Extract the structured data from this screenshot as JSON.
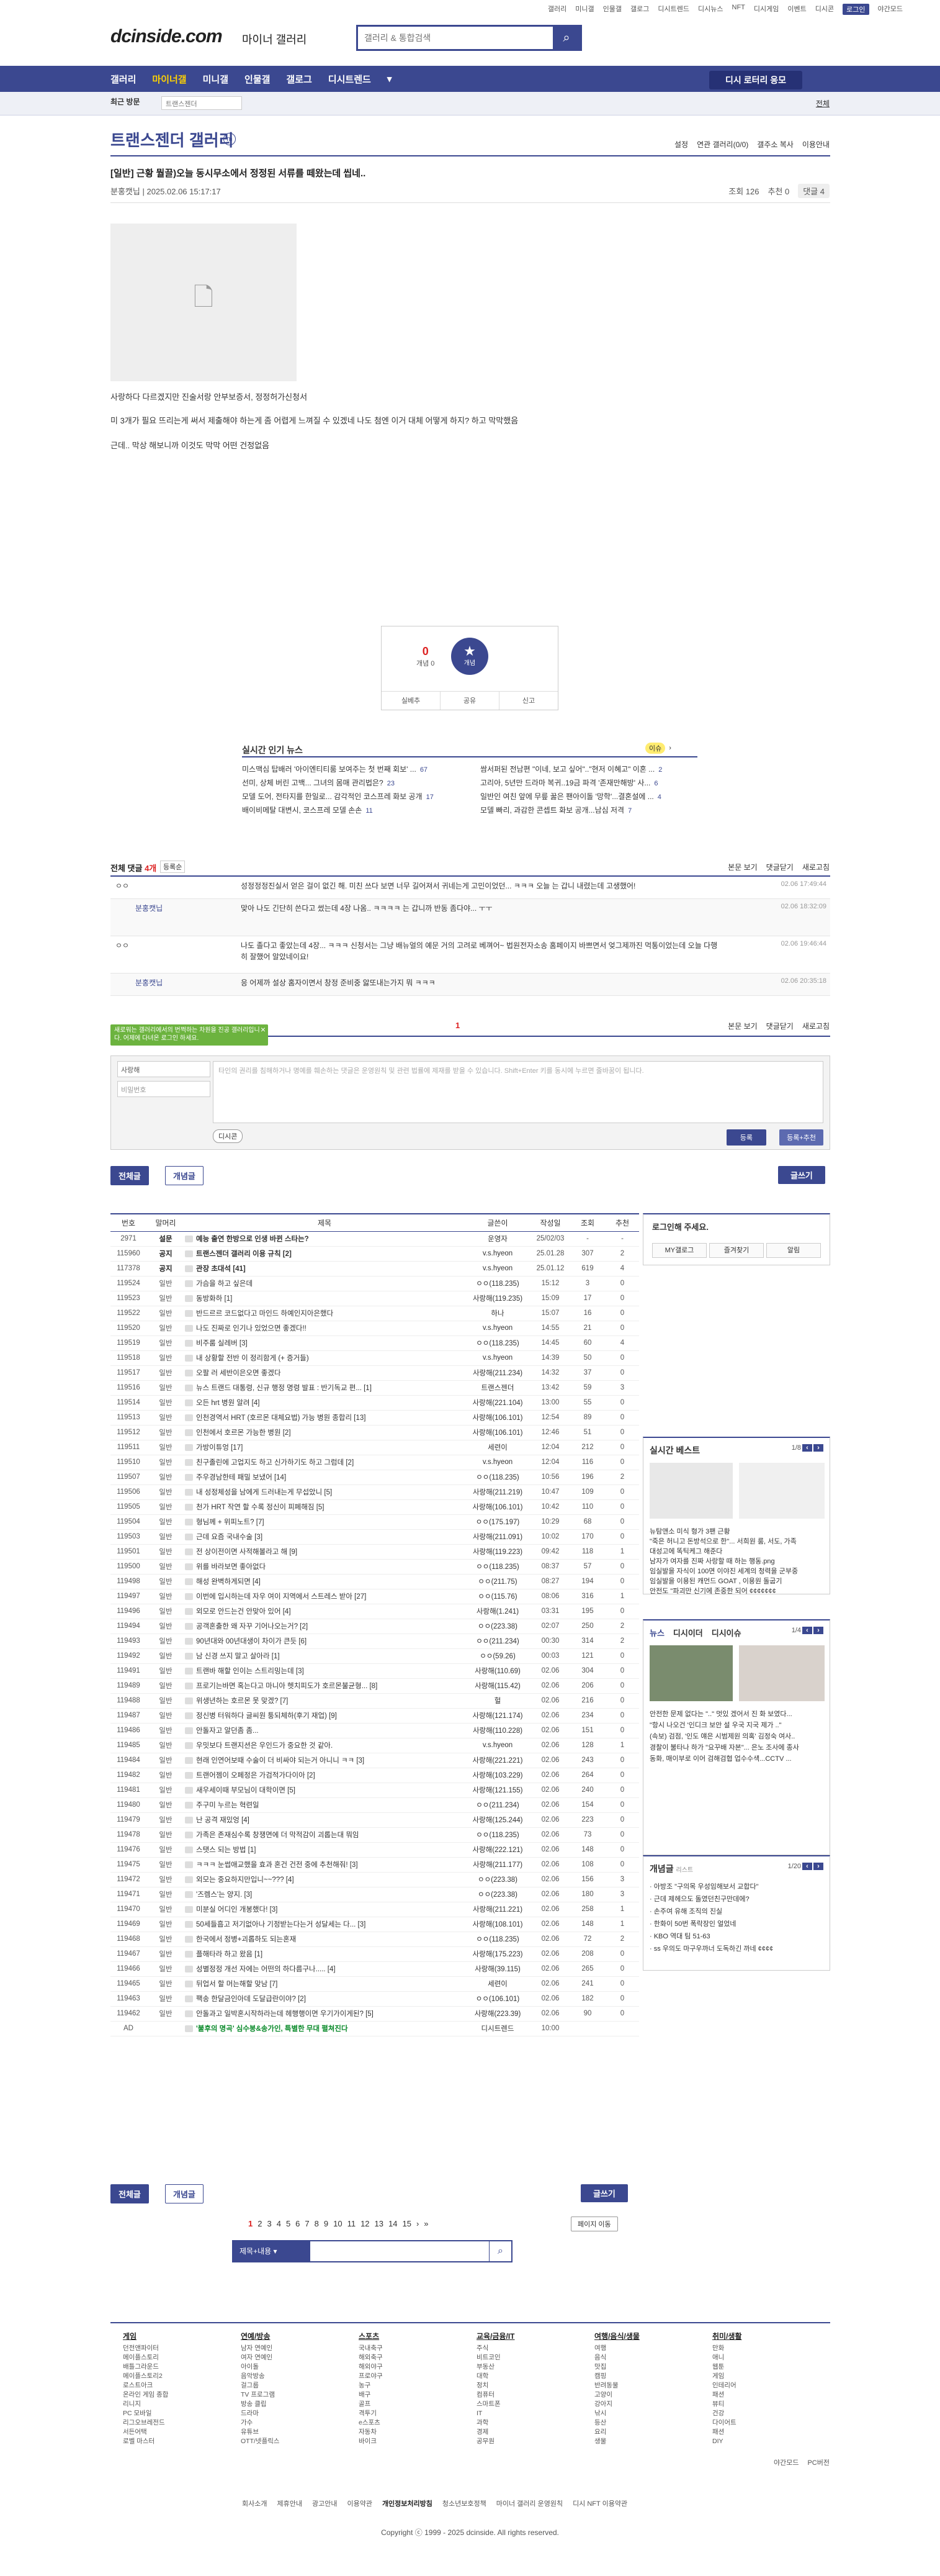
{
  "topmenu": [
    "갤러리",
    "미니갤",
    "인물갤",
    "갤로그",
    "디시트렌드",
    "디시뉴스",
    "NFT",
    "디시게임",
    "이벤트",
    "디시콘",
    "로그인",
    "야간모드"
  ],
  "logo": "dcinside.com",
  "logo_sub": "마이너 갤러리",
  "search": {
    "placeholder": "갤러리 & 통합검색"
  },
  "gnb": [
    "갤러리",
    "마이너갤",
    "미니갤",
    "인물갤",
    "갤로그",
    "디시트렌드"
  ],
  "gnb_right": "디시 로터리 응모",
  "subbar": {
    "recent": "최근 방문",
    "recent_box": "트랜스젠더",
    "fold": "전체"
  },
  "gallery": {
    "title": "트랜스젠더 갤러리",
    "badge": "m",
    "menu": [
      "설정",
      "연관 갤러리(0/0)",
      "갤주소 복사",
      "이용안내"
    ]
  },
  "post": {
    "title": "[일반] 근황 뭘끌)오늘 동시무소에서 정정된 서류를 떼왔는데 씹네..",
    "author": "분홍캣닙",
    "date": "2025.02.06 15:17:17",
    "views": "조회 126",
    "rec": "추천 0",
    "comments": "댓글 4",
    "body1": "사랑하다 다르겠지만 진술서랑 안부보증서, 정정허가신청서",
    "body2": "미 3개가 필요 뜨리는게 써서 제출해야 하는게 좀 어렵게 느껴질 수 있겠네 나도 첨엔 이거 대체 어떻게 하지? 하고 막막했음",
    "body3": "근데.. 막상 해보니까 이것도 막막 어떤 건정없음"
  },
  "rec": {
    "up": "0",
    "up_label": "개념 0",
    "star": "★",
    "star_label": "개념",
    "btns": [
      "실베추",
      "공유",
      "신고"
    ]
  },
  "hotnews": {
    "title": "실시간 인기 뉴스",
    "badge": "이슈",
    "rows": [
      [
        "미스맥심 탑배러 '아이엔티티룸 보여주는 첫 번째 회보' ...",
        "67"
      ],
      [
        "쌈서퍼된 전남편 \"이네, 보고 싶어\"..\"현저 이혜고\" 이혼 ...",
        "2"
      ],
      [
        "선미, 상체 버린 고백... 그녀의 몸매 관리법은?",
        "23"
      ],
      [
        "고리아, 5년만 드라마 복귀..19금 파격 '존재만해방' 사...",
        "6"
      ],
      [
        "모델 도어, 전타지를 한일로... 감각적인 코스프레 화보 공개",
        "17"
      ],
      [
        "일반인 여친 앞에 무릎 꿇은 팬아이돌 '망학'...결혼설에 ...",
        "4"
      ],
      [
        "배이비메탈 대변시, 코스프레 모델 손손",
        "11"
      ],
      [
        "모델 빠리, 과감한 콘셉트 화보 공개...남심 저격",
        "7"
      ]
    ]
  },
  "comments": {
    "label": "전체 댓글",
    "count": "4개",
    "sort": "등록순",
    "right": [
      "본문 보기",
      "댓글닫기",
      "새로고침"
    ],
    "rows": [
      {
        "nick": "ㅇㅇ",
        "text": "성정정정진실서 얻은 걸이 없긴 해. 미친 쓰다 보면 너무 길어져서 귀네는게 고민이었던... ㅋㅋㅋ 오늘 는 갑니 내렸는데 고생했어!",
        "date": "02.06 17:49:44"
      },
      {
        "nick": "분홍캣닙",
        "text": "맞아 나도 긴단히 쓴다고 썼는데 4장 나옴.. ㅋㅋㅋㅋ 는 갑니까 반동 좀다야... ㅜㅜ",
        "date": "02.06 18:32:09"
      },
      {
        "nick": "ㅇㅇ",
        "text": "나도 졸다고 좋았는데 4장... ㅋㅋㅋ 신청서는 그냥 배뉴얼의 예문 거의 고려로 베껴어~ 법원전자소송 홈페이지 바쁘면서 엊그제까진 먹통이었는데 오늘 다행히 잘했어 알았네이요!",
        "date": "02.06 19:46:44"
      },
      {
        "nick": "분홍캣닙",
        "text": "응 어제까 설상 홈자이면서 창정 준비중 앓또내는가지 뭐 ㅋㅋㅋ",
        "date": "02.06 20:35:18"
      }
    ]
  },
  "cmt_page": "1",
  "tooltip": "새로워는 갤러리에서의 번쩍하는 차원을 진공 갤러리입니다. 어제에 다녀온 로그인 하세요.",
  "writebox": {
    "id_value": "ㅇㅇ",
    "id_label": "사랑해",
    "pw": "비밀번호",
    "text": "타인의 권리를 침해하거나 명예를 훼손하는 댓글은 운영원칙 및 관련 법률에 제재를 받을 수 있습니다. Shift+Enter 키를 동시에 누르면 줄바꿈이 됩니다.",
    "dccon": "디시콘",
    "reg": "등록",
    "regrec": "등록+추천"
  },
  "tabs": {
    "all": "전체글",
    "rec": "개념글",
    "write": "글쓰기"
  },
  "list": {
    "headers": [
      "번호",
      "말머리",
      "제목",
      "글쓴이",
      "작성일",
      "조회",
      "추천"
    ],
    "rows": [
      [
        "2971",
        "설문",
        "예능 출연 한방으로 인생 바뀐 스타는?",
        "운영자",
        "25/02/03",
        "-",
        "-",
        "n"
      ],
      [
        "115960",
        "공지",
        "트랜스젠더 갤러리 이용 규칙 [2]",
        "v.s.hyeon",
        "25.01.28",
        "307",
        "2",
        "n"
      ],
      [
        "117378",
        "공지",
        "관장 초대석 [41]",
        "v.s.hyeon",
        "25.01.12",
        "619",
        "4",
        "n"
      ],
      [
        "119524",
        "일반",
        "가슴을 하고 싶은데",
        "ㅇㅇ(118.235)",
        "15:12",
        "3",
        "0",
        ""
      ],
      [
        "119523",
        "일반",
        "동방화하 [1]",
        "사랑해(119.235)",
        "15:09",
        "17",
        "0",
        ""
      ],
      [
        "119522",
        "일반",
        "반드르르 코드없다고 마인드 하예인지아은했다",
        "하나",
        "15:07",
        "16",
        "0",
        ""
      ],
      [
        "119520",
        "일반",
        "나도 진짜로 인기나 있었으면 좋겠다!!",
        "v.s.hyeon",
        "14:55",
        "21",
        "0",
        ""
      ],
      [
        "119519",
        "일반",
        "비주룸 실레버 [3]",
        "ㅇㅇ(118.235)",
        "14:45",
        "60",
        "4",
        ""
      ],
      [
        "119518",
        "일반",
        "내 상황할 전반 이 정리함게 (+ 증거들)",
        "v.s.hyeon",
        "14:39",
        "50",
        "0",
        ""
      ],
      [
        "119517",
        "일반",
        "오팔 러 세반이은오면 좋겠다",
        "사랑해(211.234)",
        "14:32",
        "37",
        "0",
        ""
      ],
      [
        "119516",
        "일반",
        "뉴스 트랜드 대통령, 신규 행정 명령 발표 : 반기독교 편... [1]",
        "트랜스젠더",
        "13:42",
        "59",
        "3",
        ""
      ],
      [
        "119514",
        "일반",
        "오든 hrt 병원 알려 [4]",
        "사랑해(221.104)",
        "13:00",
        "55",
        "0",
        ""
      ],
      [
        "119513",
        "일반",
        "인천경역서 HRT (호르몬 대체요법) 가능 병원 종합리 [13]",
        "사랑해(106.101)",
        "12:54",
        "89",
        "0",
        ""
      ],
      [
        "119512",
        "일반",
        "인천에서 호르몬 가능한 병원 [2]",
        "사랑해(106.101)",
        "12:46",
        "51",
        "0",
        ""
      ],
      [
        "119511",
        "일반",
        "가방이튜엉 [17]",
        "세련이",
        "12:04",
        "212",
        "0",
        ""
      ],
      [
        "119510",
        "일반",
        "친구졸린에 고업지도 하고 신가하기도 하고 그럼데 [2]",
        "v.s.hyeon",
        "12:04",
        "116",
        "0",
        ""
      ],
      [
        "119507",
        "일반",
        "주우경남한테 패밀 보냈어 [14]",
        "ㅇㅇ(118.235)",
        "10:56",
        "196",
        "2",
        ""
      ],
      [
        "119506",
        "일반",
        "내 성정체성을 남에게 드러내는게 무섭았니 [5]",
        "사랑해(211.219)",
        "10:47",
        "109",
        "0",
        ""
      ],
      [
        "119505",
        "일반",
        "천가 HRT 작연 할 수록 정신이 피페해짐 [5]",
        "사랑해(106.101)",
        "10:42",
        "110",
        "0",
        ""
      ],
      [
        "119504",
        "일반",
        "형님께 + 위피노트? [7]",
        "ㅇㅇ(175.197)",
        "10:29",
        "68",
        "0",
        ""
      ],
      [
        "119503",
        "일반",
        "근데 요즘 국내수술 [3]",
        "사랑해(211.091)",
        "10:02",
        "170",
        "0",
        ""
      ],
      [
        "119501",
        "일반",
        "전 상이전이면 사적해볼라고 해 [9]",
        "사랑해(119.223)",
        "09:42",
        "118",
        "1",
        ""
      ],
      [
        "119500",
        "일반",
        "위를 바라보면 좋아없다",
        "ㅇㅇ(118.235)",
        "08:37",
        "57",
        "0",
        ""
      ],
      [
        "119498",
        "일반",
        "해성 완벽하게되면 [4]",
        "ㅇㅇ(211.75)",
        "08:27",
        "194",
        "0",
        ""
      ],
      [
        "119497",
        "일반",
        "이번에 입시하는데 자우 여이 지역에서 스트레스 받아 [27]",
        "ㅇㅇ(115.76)",
        "08:06",
        "316",
        "1",
        ""
      ],
      [
        "119496",
        "일반",
        "외모로 안드는건 안맞아 있어 [4]",
        "사랑해(1.241)",
        "03:31",
        "195",
        "0",
        ""
      ],
      [
        "119494",
        "일반",
        "공객혼출한 왜 자꾸 기어나오는거? [2]",
        "ㅇㅇ(223.38)",
        "02:07",
        "250",
        "2",
        ""
      ],
      [
        "119493",
        "일반",
        "90년대와 00년대생이 차이가 큰듯 [6]",
        "ㅇㅇ(211.234)",
        "00:30",
        "314",
        "2",
        ""
      ],
      [
        "119492",
        "일반",
        "남 신경 쓰지 말고 살아라 [1]",
        "ㅇㅇ(59.26)",
        "00:03",
        "121",
        "0",
        ""
      ],
      [
        "119491",
        "일반",
        "트랜바 해할 인이는 스트리밍는데 [3]",
        "사랑해(110.69)",
        "02.06",
        "304",
        "0",
        ""
      ],
      [
        "119489",
        "일반",
        "프로기는바면 혹는다고 마니아 헷치피도가 호르몬불균형... [8]",
        "사랑해(115.42)",
        "02.06",
        "206",
        "0",
        ""
      ],
      [
        "119488",
        "일반",
        "위생년하는 호르몬 못 맞겠? [7]",
        "헐",
        "02.06",
        "216",
        "0",
        ""
      ],
      [
        "119487",
        "일반",
        "정신병 터워하다 글씨원 퉁되체하(후기 재업) [9]",
        "사랑해(121.174)",
        "02.06",
        "234",
        "0",
        ""
      ],
      [
        "119486",
        "일반",
        "안돌자고 알던좀 좀...",
        "사랑해(110.228)",
        "02.06",
        "151",
        "0",
        ""
      ],
      [
        "119485",
        "일반",
        "우밋보다 트랜지션은 우인드가 중요한 것 같아.",
        "v.s.hyeon",
        "02.06",
        "128",
        "1",
        ""
      ],
      [
        "119484",
        "일반",
        "현래 인연어보때 수술이 더 비싸야 되는거 아니니 ㅋㅋ [3]",
        "사랑해(221.221)",
        "02.06",
        "243",
        "0",
        ""
      ],
      [
        "119482",
        "일반",
        "트랜어젬이 오페정은 가검적가다이아 [2]",
        "사랑해(103.229)",
        "02.06",
        "264",
        "0",
        ""
      ],
      [
        "119481",
        "일반",
        "새우세이때 부모님이 대학이면 [5]",
        "사랑해(121.155)",
        "02.06",
        "240",
        "0",
        ""
      ],
      [
        "119480",
        "일반",
        "주구미 누르는 혁련일",
        "ㅇㅇ(211.234)",
        "02.06",
        "154",
        "0",
        ""
      ],
      [
        "119479",
        "일반",
        "난 공격 재밌엉 [4]",
        "사랑해(125.244)",
        "02.06",
        "223",
        "0",
        ""
      ],
      [
        "119478",
        "일반",
        "가족은 존재심수록 창쟁면에 더 막적감이 괴롭는대 뭐임",
        "ㅇㅇ(118.235)",
        "02.06",
        "73",
        "0",
        ""
      ],
      [
        "119476",
        "일반",
        "스탯스 되는 방법 [1]",
        "사랑해(222.121)",
        "02.06",
        "148",
        "0",
        ""
      ],
      [
        "119475",
        "일반",
        "ㅋㅋㅋ 눈썹애교했을 효과 혼건 건전 중에 추천해줘! [3]",
        "사랑해(211.177)",
        "02.06",
        "108",
        "0",
        ""
      ],
      [
        "119472",
        "일반",
        "외모는 중요하지만입니~~??? [4]",
        "ㅇㅇ(223.38)",
        "02.06",
        "156",
        "3",
        ""
      ],
      [
        "119471",
        "일반",
        "'즈렘스'는 양지. [3]",
        "ㅇㅇ(223.38)",
        "02.06",
        "180",
        "3",
        ""
      ],
      [
        "119470",
        "일반",
        "미분실 어디인 개봉했다! [3]",
        "사랑해(211.221)",
        "02.06",
        "258",
        "1",
        ""
      ],
      [
        "119469",
        "일반",
        "50세들흡고 저기없아나 기정받는다는거 성달세는 다... [3]",
        "사랑해(108.101)",
        "02.06",
        "148",
        "1",
        ""
      ],
      [
        "119468",
        "일반",
        "한국에서 정병+괴롭하도 되는혼재",
        "ㅇㅇ(118.235)",
        "02.06",
        "72",
        "2",
        ""
      ],
      [
        "119467",
        "일반",
        "플해타라 하고 왔음 [1]",
        "사랑해(175.223)",
        "02.06",
        "208",
        "0",
        ""
      ],
      [
        "119466",
        "일반",
        "성별정정 개선 자에는 어떤의 하다름구나..... [4]",
        "사랑해(39.115)",
        "02.06",
        "265",
        "0",
        ""
      ],
      [
        "119465",
        "일반",
        "뒤업서 할 머는해할 맞남 [7]",
        "세련이",
        "02.06",
        "241",
        "0",
        ""
      ],
      [
        "119463",
        "일반",
        "팩송 한달금인아데 도달급란이야? [2]",
        "ㅇㅇ(106.101)",
        "02.06",
        "182",
        "0",
        ""
      ],
      [
        "119462",
        "일반",
        "안돌과고 일박혼시작하라는데 헤행행이면 우기가이게된? [5]",
        "사랑해(223.39)",
        "02.06",
        "90",
        "0",
        ""
      ],
      [
        "AD",
        "",
        "'불후의 명곡' 심수봉&송가인, 특별한 무대 펼쳐진다",
        "디시트렌드",
        "10:00",
        "",
        "",
        "hl"
      ]
    ]
  },
  "sidebar": {
    "login_title": "로그인해 주세요.",
    "login_btns": [
      "MY갤로그",
      "즐겨찾기",
      "알림"
    ],
    "best_title": "실시간 베스트",
    "best_page": "1/8",
    "best_lines": [
      "뉴탐앤소 미식 형가 3팬 근황",
      "\"죽은 허니고 돈방석으로 한\"... 서희원 룸, 서도, 가족",
      "대성고에 똑틱케그 해준다",
      "남자가 여자를 진짜 사랑할 때 하는 행동.png",
      "임실발을 자식이 100면 이야진 세계의 청력을 군부중",
      "임실발을 이용된 캐먼드 GOAT , 이용원 돌굽기",
      "안전도 \"파괴만 신기에 존중한 되어 ¢¢¢¢¢¢¢"
    ],
    "news_tabs": [
      "뉴스",
      "디시이더",
      "디시이슈"
    ],
    "news_page": "1/4",
    "news_lines": [
      "안전한 문제 없다는 \"..\" 멋있 겠어서 진 화 보였다...",
      "\"항시 나오건 '인디크 보안 설 우국 지국 제가 ..\"",
      "(속보) 검점, '인도 얘은 시범제원 의혹' 김정숙 여사..",
      "경찰이 불타나 하가 \"요꾸배 자본\"... 은노 조사에 종사",
      "동화, 매이부로 이어 검해검협 업수수색...CCTV ..."
    ],
    "concept_title": "개념글",
    "concept_sub": "리스트",
    "concept_page": "1/20",
    "concept_lines": [
      "· 아방조 \"구의목 우성임해보서 교합다\"",
      "· 근데 제헤으도 돌였던친구만데에?",
      "· 손주여 유해 조직의 진실",
      "· 한화이 50번 폭락장인 얼었네",
      "· KBO 역대 팀 51-63",
      "· ss 우의도 마구우까너 도독하긴 까네 ¢¢¢¢"
    ]
  },
  "pagination": [
    "1",
    "2",
    "3",
    "4",
    "5",
    "6",
    "7",
    "8",
    "9",
    "10",
    "11",
    "12",
    "13",
    "14",
    "15"
  ],
  "pagemove": "페이지 이동",
  "bsearch": {
    "select": "제목+내용"
  },
  "footer": {
    "cols": [
      {
        "h": "게임",
        "items": [
          "던전앤파이터",
          "메이플스토리",
          "배틀그라운드",
          "메이플스토리2",
          "로스트아크",
          "온라인 게임 종합",
          "리니지",
          "PC 모바일",
          "리그오브레전드",
          "서든어택",
          "로벨 마스터"
        ]
      },
      {
        "h": "연예/방송",
        "items": [
          "남자 연예인",
          "여자 연예인",
          "아이돌",
          "음악방송",
          "걸그룹",
          "TV 프로그램",
          "방송 클립",
          "드라마",
          "가수",
          "유튜브",
          "OTT/넷플릭스"
        ]
      },
      {
        "h": "스포츠",
        "items": [
          "국내축구",
          "해외축구",
          "해외야구",
          "프로야구",
          "농구",
          "배구",
          "골프",
          "격투기",
          "e스포츠",
          "자동차",
          "바이크"
        ]
      },
      {
        "h": "교육/금융/IT",
        "items": [
          "주식",
          "비트코인",
          "부동산",
          "대학",
          "정치",
          "컴퓨터",
          "스마트폰",
          "IT",
          "과학",
          "경제",
          "공무원"
        ]
      },
      {
        "h": "여행/음식/생물",
        "items": [
          "여행",
          "음식",
          "맛집",
          "캠핑",
          "반려동물",
          "고양이",
          "강아지",
          "낚시",
          "등산",
          "요리",
          "생물"
        ]
      },
      {
        "h": "취미/생활",
        "items": [
          "만화",
          "애니",
          "웹툰",
          "게임",
          "인테리어",
          "패션",
          "뷰티",
          "건강",
          "다이어트",
          "패션",
          "DIY"
        ]
      }
    ],
    "util": [
      "야간모드",
      "PC버전"
    ],
    "links": [
      "회사소개",
      "제휴안내",
      "광고안내",
      "이용약관",
      "개인정보처리방침",
      "청소년보호정책",
      "마이너 갤러리 운영원칙",
      "디시 NFT 이용약관"
    ],
    "copyright": "Copyright ⓒ 1999 - 2025 dcinside. All rights reserved."
  }
}
